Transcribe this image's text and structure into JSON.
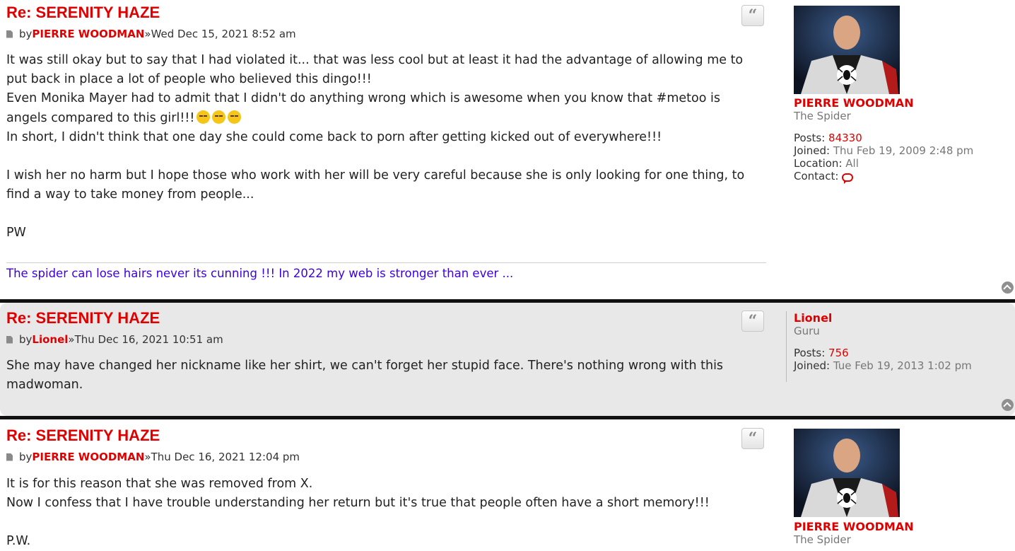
{
  "posts": [
    {
      "title": "Re: SERENITY HAZE",
      "by": "by",
      "author": "PIERRE WOODMAN",
      "sep": "»",
      "date": "Wed Dec 15, 2021 8:52 am",
      "lines": [
        "It was still okay but to say that I had violated it... that was less cool but at least it had the advantage of allowing me to put back in place a lot of people who believed this dingo!!!",
        "Even Monika Mayer had to admit that I didn't do anything wrong which is awesome when you know that #metoo is angels compared to this girl!!!",
        "In short, I didn't think that one day she could come back to porn after getting kicked out of everywhere!!!",
        "I wish her no harm but I hope those who work with her will be very careful because she is only looking for one thing, to find a way to take money from people...",
        "PW"
      ],
      "signature": "The spider can lose hairs never its cunning !!! In 2022 my web is stronger than ever ...",
      "profile": {
        "username": "PIERRE WOODMAN",
        "rank": "The Spider",
        "posts_label": "Posts:",
        "posts": "84330",
        "joined_label": "Joined:",
        "joined": "Thu Feb 19, 2009 2:48 pm",
        "location_label": "Location:",
        "location": "All",
        "contact_label": "Contact:"
      }
    },
    {
      "title": "Re: SERENITY HAZE",
      "by": "by",
      "author": "Lionel",
      "sep": "»",
      "date": "Thu Dec 16, 2021 10:51 am",
      "lines": [
        "She may have changed her nickname like her shirt, we can't forget her stupid face. There's nothing wrong with this madwoman."
      ],
      "profile": {
        "username": "Lionel",
        "rank": "Guru",
        "posts_label": "Posts:",
        "posts": "756",
        "joined_label": "Joined:",
        "joined": "Tue Feb 19, 2013 1:02 pm"
      }
    },
    {
      "title": "Re: SERENITY HAZE",
      "by": "by",
      "author": "PIERRE WOODMAN",
      "sep": "»",
      "date": "Thu Dec 16, 2021 12:04 pm",
      "lines": [
        "It is for this reason that she was removed from X.",
        "Now I confess that I have trouble understanding her return but it's true that people often have a short memory!!!",
        "P.W."
      ],
      "profile": {
        "username": "PIERRE WOODMAN",
        "rank": "The Spider"
      }
    }
  ],
  "icons": {
    "quote": "quote-icon",
    "post": "post-document-icon",
    "top": "back-to-top-icon",
    "contact": "chat-bubble-icon",
    "emoji": "laughing-crying-emoji"
  },
  "colors": {
    "accent": "#e00000",
    "signature": "#3d00e0",
    "alt_post_bg": "#e8e8e8"
  }
}
